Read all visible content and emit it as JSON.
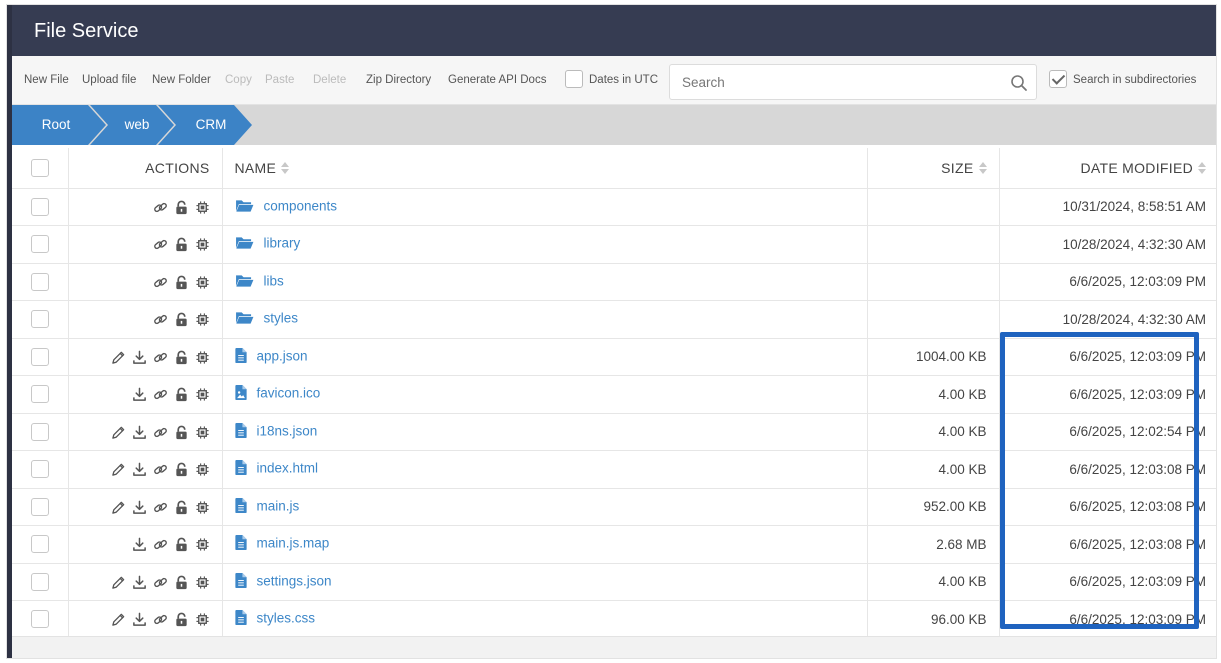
{
  "app": {
    "title": "File Service"
  },
  "toolbar": {
    "new_file": "New File",
    "upload_file": "Upload file",
    "new_folder": "New Folder",
    "copy": "Copy",
    "paste": "Paste",
    "delete": "Delete",
    "zip_directory": "Zip Directory",
    "generate_api_docs": "Generate API Docs",
    "dates_in_utc": {
      "label": "Dates in UTC",
      "checked": false
    },
    "search": {
      "placeholder": "Search",
      "value": ""
    },
    "search_subdirs": {
      "label": "Search in subdirectories",
      "checked": true
    }
  },
  "breadcrumb": [
    "Root",
    "web",
    "CRM"
  ],
  "table": {
    "columns": {
      "actions": "ACTIONS",
      "name": "NAME",
      "size": "SIZE",
      "date": "DATE MODIFIED"
    },
    "rows": [
      {
        "type": "folder",
        "name": "components",
        "size": "",
        "date": "10/31/2024, 8:58:51 AM",
        "actions": [
          "link",
          "lock",
          "chip"
        ]
      },
      {
        "type": "folder",
        "name": "library",
        "size": "",
        "date": "10/28/2024, 4:32:30 AM",
        "actions": [
          "link",
          "lock",
          "chip"
        ]
      },
      {
        "type": "folder",
        "name": "libs",
        "size": "",
        "date": "6/6/2025, 12:03:09 PM",
        "actions": [
          "link",
          "lock",
          "chip"
        ]
      },
      {
        "type": "folder",
        "name": "styles",
        "size": "",
        "date": "10/28/2024, 4:32:30 AM",
        "actions": [
          "link",
          "lock",
          "chip"
        ]
      },
      {
        "type": "file",
        "name": "app.json",
        "size": "1004.00 KB",
        "date": "6/6/2025, 12:03:09 PM",
        "actions": [
          "edit",
          "download",
          "link",
          "lock",
          "chip"
        ]
      },
      {
        "type": "image",
        "name": "favicon.ico",
        "size": "4.00 KB",
        "date": "6/6/2025, 12:03:09 PM",
        "actions": [
          "download",
          "link",
          "lock",
          "chip"
        ]
      },
      {
        "type": "file",
        "name": "i18ns.json",
        "size": "4.00 KB",
        "date": "6/6/2025, 12:02:54 PM",
        "actions": [
          "edit",
          "download",
          "link",
          "lock",
          "chip"
        ]
      },
      {
        "type": "file",
        "name": "index.html",
        "size": "4.00 KB",
        "date": "6/6/2025, 12:03:08 PM",
        "actions": [
          "edit",
          "download",
          "link",
          "lock",
          "chip"
        ]
      },
      {
        "type": "file",
        "name": "main.js",
        "size": "952.00 KB",
        "date": "6/6/2025, 12:03:08 PM",
        "actions": [
          "edit",
          "download",
          "link",
          "lock",
          "chip"
        ]
      },
      {
        "type": "file",
        "name": "main.js.map",
        "size": "2.68 MB",
        "date": "6/6/2025, 12:03:08 PM",
        "actions": [
          "download",
          "link",
          "lock",
          "chip"
        ]
      },
      {
        "type": "file",
        "name": "settings.json",
        "size": "4.00 KB",
        "date": "6/6/2025, 12:03:09 PM",
        "actions": [
          "edit",
          "download",
          "link",
          "lock",
          "chip"
        ]
      },
      {
        "type": "file",
        "name": "styles.css",
        "size": "96.00 KB",
        "date": "6/6/2025, 12:03:09 PM",
        "actions": [
          "edit",
          "download",
          "link",
          "lock",
          "chip"
        ]
      }
    ]
  },
  "colors": {
    "header": "#363c52",
    "accent": "#3c83c6",
    "highlight": "#1f63bf"
  }
}
